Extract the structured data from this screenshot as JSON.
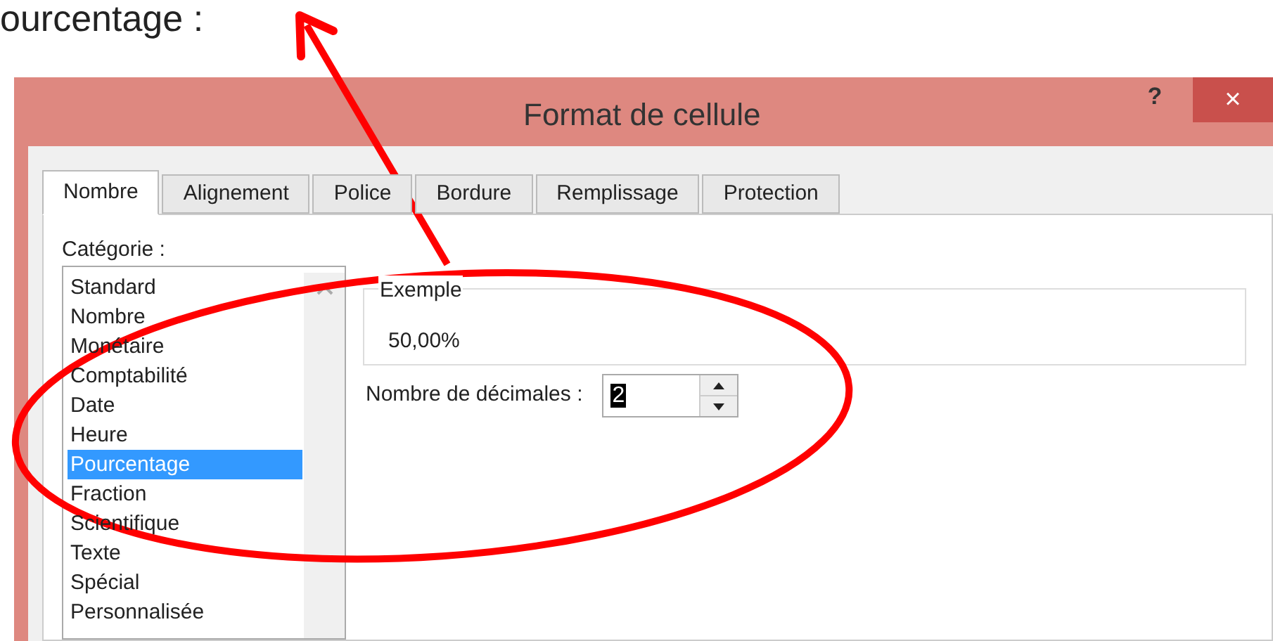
{
  "heading": "ourcentage :",
  "window": {
    "title": "Format de cellule",
    "help": "?",
    "close": "×"
  },
  "tabs": [
    {
      "label": "Nombre",
      "selected": true
    },
    {
      "label": "Alignement",
      "selected": false
    },
    {
      "label": "Police",
      "selected": false
    },
    {
      "label": "Bordure",
      "selected": false
    },
    {
      "label": "Remplissage",
      "selected": false
    },
    {
      "label": "Protection",
      "selected": false
    }
  ],
  "category": {
    "label": "Catégorie :",
    "items": [
      {
        "label": "Standard",
        "selected": false
      },
      {
        "label": "Nombre",
        "selected": false
      },
      {
        "label": "Monétaire",
        "selected": false
      },
      {
        "label": "Comptabilité",
        "selected": false
      },
      {
        "label": "Date",
        "selected": false
      },
      {
        "label": "Heure",
        "selected": false
      },
      {
        "label": "Pourcentage",
        "selected": true
      },
      {
        "label": "Fraction",
        "selected": false
      },
      {
        "label": "Scientifique",
        "selected": false
      },
      {
        "label": "Texte",
        "selected": false
      },
      {
        "label": "Spécial",
        "selected": false
      },
      {
        "label": "Personnalisée",
        "selected": false
      }
    ]
  },
  "example": {
    "label": "Exemple",
    "value": "50,00%"
  },
  "decimals": {
    "label": "Nombre de décimales :",
    "value": "2"
  }
}
